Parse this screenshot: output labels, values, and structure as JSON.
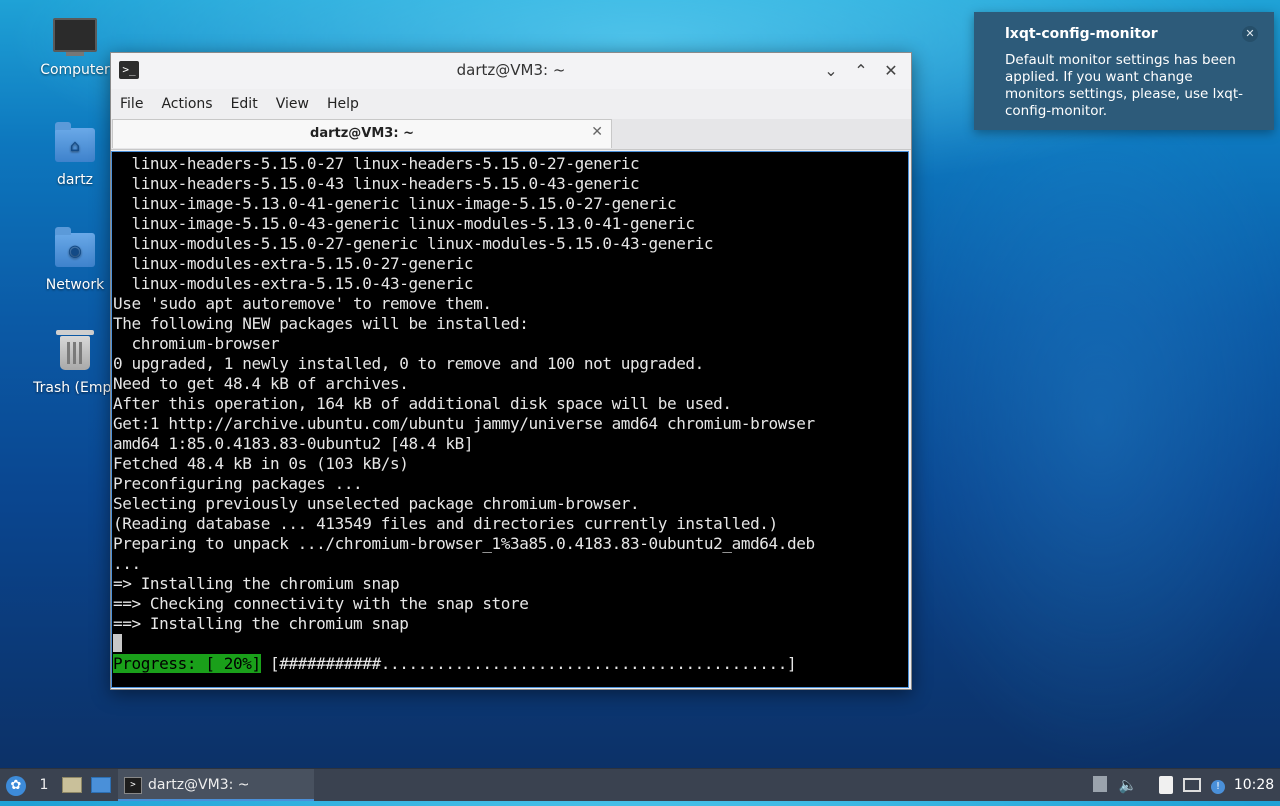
{
  "desktop": {
    "icons": [
      {
        "label": "Computer"
      },
      {
        "label": "dartz"
      },
      {
        "label": "Network"
      },
      {
        "label": "Trash (Empt"
      }
    ]
  },
  "window": {
    "title": "dartz@VM3: ~",
    "menu": [
      "File",
      "Actions",
      "Edit",
      "View",
      "Help"
    ],
    "tab_label": "dartz@VM3: ~",
    "terminal_lines": [
      "  linux-headers-5.15.0-27 linux-headers-5.15.0-27-generic",
      "  linux-headers-5.15.0-43 linux-headers-5.15.0-43-generic",
      "  linux-image-5.13.0-41-generic linux-image-5.15.0-27-generic",
      "  linux-image-5.15.0-43-generic linux-modules-5.13.0-41-generic",
      "  linux-modules-5.15.0-27-generic linux-modules-5.15.0-43-generic",
      "  linux-modules-extra-5.15.0-27-generic",
      "  linux-modules-extra-5.15.0-43-generic",
      "Use 'sudo apt autoremove' to remove them.",
      "The following NEW packages will be installed:",
      "  chromium-browser",
      "0 upgraded, 1 newly installed, 0 to remove and 100 not upgraded.",
      "Need to get 48.4 kB of archives.",
      "After this operation, 164 kB of additional disk space will be used.",
      "Get:1 http://archive.ubuntu.com/ubuntu jammy/universe amd64 chromium-browser",
      "amd64 1:85.0.4183.83-0ubuntu2 [48.4 kB]",
      "Fetched 48.4 kB in 0s (103 kB/s)",
      "Preconfiguring packages ...",
      "Selecting previously unselected package chromium-browser.",
      "(Reading database ... 413549 files and directories currently installed.)",
      "Preparing to unpack .../chromium-browser_1%3a85.0.4183.83-0ubuntu2_amd64.deb",
      "...",
      "=> Installing the chromium snap",
      "==> Checking connectivity with the snap store",
      "==> Installing the chromium snap"
    ],
    "progress_label": "Progress: [ 20%]",
    "progress_bar": " [###########............................................]",
    "progress_percent": 20
  },
  "notification": {
    "title": "lxqt-config-monitor",
    "body": "Default monitor settings has been applied. If you want change monitors settings, please, use lxqt-config-monitor."
  },
  "taskbar": {
    "desktop_number": "1",
    "task_label": "dartz@VM3: ~",
    "clock": "10:28"
  },
  "colors": {
    "progress_green": "#1aa01a",
    "notification_bg": "#2d5b7a",
    "taskbar_bg": "#3a4250",
    "accent": "#4a90d9"
  }
}
